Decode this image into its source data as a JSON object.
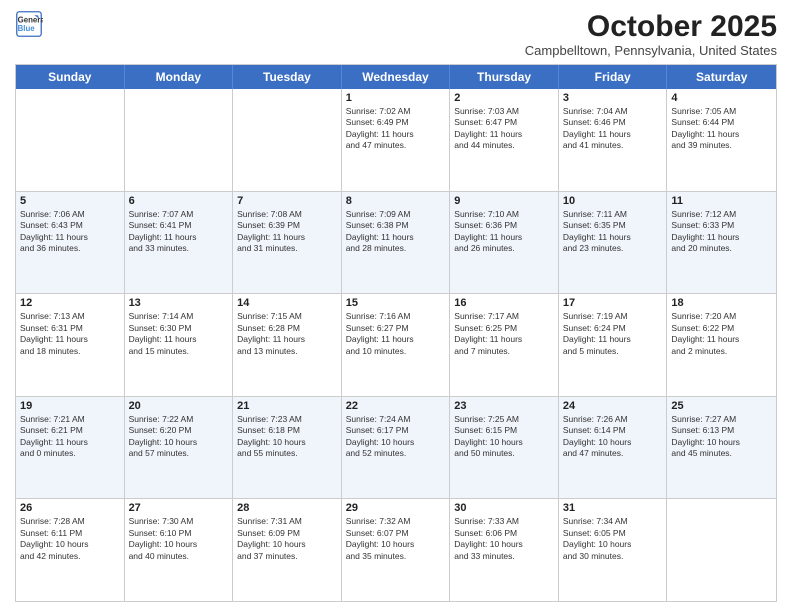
{
  "logo": {
    "line1": "General",
    "line2": "Blue"
  },
  "title": "October 2025",
  "subtitle": "Campbelltown, Pennsylvania, United States",
  "days": [
    "Sunday",
    "Monday",
    "Tuesday",
    "Wednesday",
    "Thursday",
    "Friday",
    "Saturday"
  ],
  "weeks": [
    [
      {
        "day": "",
        "info": ""
      },
      {
        "day": "",
        "info": ""
      },
      {
        "day": "",
        "info": ""
      },
      {
        "day": "1",
        "info": "Sunrise: 7:02 AM\nSunset: 6:49 PM\nDaylight: 11 hours\nand 47 minutes."
      },
      {
        "day": "2",
        "info": "Sunrise: 7:03 AM\nSunset: 6:47 PM\nDaylight: 11 hours\nand 44 minutes."
      },
      {
        "day": "3",
        "info": "Sunrise: 7:04 AM\nSunset: 6:46 PM\nDaylight: 11 hours\nand 41 minutes."
      },
      {
        "day": "4",
        "info": "Sunrise: 7:05 AM\nSunset: 6:44 PM\nDaylight: 11 hours\nand 39 minutes."
      }
    ],
    [
      {
        "day": "5",
        "info": "Sunrise: 7:06 AM\nSunset: 6:43 PM\nDaylight: 11 hours\nand 36 minutes."
      },
      {
        "day": "6",
        "info": "Sunrise: 7:07 AM\nSunset: 6:41 PM\nDaylight: 11 hours\nand 33 minutes."
      },
      {
        "day": "7",
        "info": "Sunrise: 7:08 AM\nSunset: 6:39 PM\nDaylight: 11 hours\nand 31 minutes."
      },
      {
        "day": "8",
        "info": "Sunrise: 7:09 AM\nSunset: 6:38 PM\nDaylight: 11 hours\nand 28 minutes."
      },
      {
        "day": "9",
        "info": "Sunrise: 7:10 AM\nSunset: 6:36 PM\nDaylight: 11 hours\nand 26 minutes."
      },
      {
        "day": "10",
        "info": "Sunrise: 7:11 AM\nSunset: 6:35 PM\nDaylight: 11 hours\nand 23 minutes."
      },
      {
        "day": "11",
        "info": "Sunrise: 7:12 AM\nSunset: 6:33 PM\nDaylight: 11 hours\nand 20 minutes."
      }
    ],
    [
      {
        "day": "12",
        "info": "Sunrise: 7:13 AM\nSunset: 6:31 PM\nDaylight: 11 hours\nand 18 minutes."
      },
      {
        "day": "13",
        "info": "Sunrise: 7:14 AM\nSunset: 6:30 PM\nDaylight: 11 hours\nand 15 minutes."
      },
      {
        "day": "14",
        "info": "Sunrise: 7:15 AM\nSunset: 6:28 PM\nDaylight: 11 hours\nand 13 minutes."
      },
      {
        "day": "15",
        "info": "Sunrise: 7:16 AM\nSunset: 6:27 PM\nDaylight: 11 hours\nand 10 minutes."
      },
      {
        "day": "16",
        "info": "Sunrise: 7:17 AM\nSunset: 6:25 PM\nDaylight: 11 hours\nand 7 minutes."
      },
      {
        "day": "17",
        "info": "Sunrise: 7:19 AM\nSunset: 6:24 PM\nDaylight: 11 hours\nand 5 minutes."
      },
      {
        "day": "18",
        "info": "Sunrise: 7:20 AM\nSunset: 6:22 PM\nDaylight: 11 hours\nand 2 minutes."
      }
    ],
    [
      {
        "day": "19",
        "info": "Sunrise: 7:21 AM\nSunset: 6:21 PM\nDaylight: 11 hours\nand 0 minutes."
      },
      {
        "day": "20",
        "info": "Sunrise: 7:22 AM\nSunset: 6:20 PM\nDaylight: 10 hours\nand 57 minutes."
      },
      {
        "day": "21",
        "info": "Sunrise: 7:23 AM\nSunset: 6:18 PM\nDaylight: 10 hours\nand 55 minutes."
      },
      {
        "day": "22",
        "info": "Sunrise: 7:24 AM\nSunset: 6:17 PM\nDaylight: 10 hours\nand 52 minutes."
      },
      {
        "day": "23",
        "info": "Sunrise: 7:25 AM\nSunset: 6:15 PM\nDaylight: 10 hours\nand 50 minutes."
      },
      {
        "day": "24",
        "info": "Sunrise: 7:26 AM\nSunset: 6:14 PM\nDaylight: 10 hours\nand 47 minutes."
      },
      {
        "day": "25",
        "info": "Sunrise: 7:27 AM\nSunset: 6:13 PM\nDaylight: 10 hours\nand 45 minutes."
      }
    ],
    [
      {
        "day": "26",
        "info": "Sunrise: 7:28 AM\nSunset: 6:11 PM\nDaylight: 10 hours\nand 42 minutes."
      },
      {
        "day": "27",
        "info": "Sunrise: 7:30 AM\nSunset: 6:10 PM\nDaylight: 10 hours\nand 40 minutes."
      },
      {
        "day": "28",
        "info": "Sunrise: 7:31 AM\nSunset: 6:09 PM\nDaylight: 10 hours\nand 37 minutes."
      },
      {
        "day": "29",
        "info": "Sunrise: 7:32 AM\nSunset: 6:07 PM\nDaylight: 10 hours\nand 35 minutes."
      },
      {
        "day": "30",
        "info": "Sunrise: 7:33 AM\nSunset: 6:06 PM\nDaylight: 10 hours\nand 33 minutes."
      },
      {
        "day": "31",
        "info": "Sunrise: 7:34 AM\nSunset: 6:05 PM\nDaylight: 10 hours\nand 30 minutes."
      },
      {
        "day": "",
        "info": ""
      }
    ]
  ]
}
